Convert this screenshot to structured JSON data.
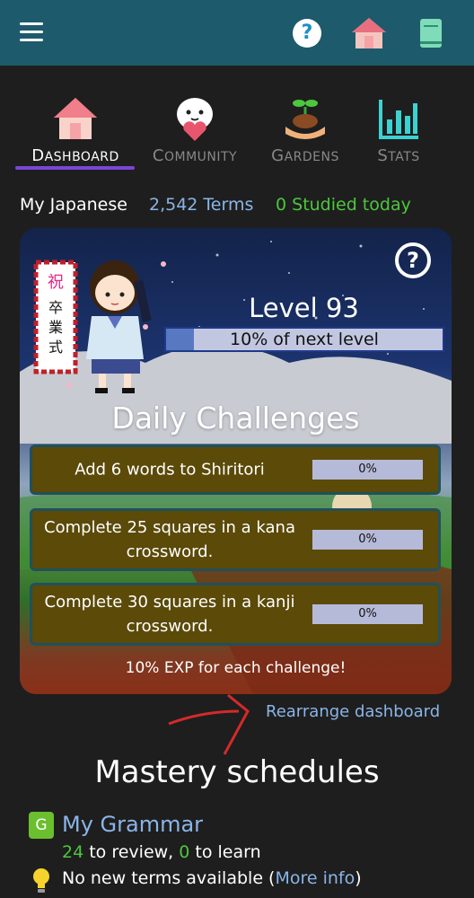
{
  "topbar": {
    "menu_icon": "hamburger-menu-icon",
    "help_icon": "question-circle-icon",
    "home_icon": "house-icon",
    "notebook_icon": "notebook-icon"
  },
  "tabs": [
    {
      "cap": "D",
      "rest": "ASHBOARD",
      "icon": "house-icon",
      "active": true
    },
    {
      "cap": "C",
      "rest": "OMMUNITY",
      "icon": "smiley-heart-icon",
      "active": false
    },
    {
      "cap": "G",
      "rest": "ARDENS",
      "icon": "sprout-hand-icon",
      "active": false
    },
    {
      "cap": "S",
      "rest": "TATS",
      "icon": "bar-chart-icon",
      "active": false
    }
  ],
  "subject": {
    "name": "My Japanese",
    "terms": "2,542 Terms",
    "studied": "0 Studied today"
  },
  "card": {
    "sign_text": "祝卒業式",
    "level": "Level 93",
    "level_progress": 0.1,
    "level_text": "10% of next level",
    "daily_title": "Daily Challenges",
    "challenges": [
      {
        "text": "Add 6 words to Shiritori",
        "progress": "0%"
      },
      {
        "text": "Complete 25 squares in a kana crossword.",
        "progress": "0%"
      },
      {
        "text": "Complete 30 squares in a kanji crossword.",
        "progress": "0%"
      }
    ],
    "exp_note": "10% EXP for each challenge!"
  },
  "rearrange_link": "Rearrange dashboard",
  "mastery": {
    "title": "Mastery schedules",
    "badge": "G",
    "grammar_name": "My Grammar",
    "review_count": "24",
    "review_text": " to review, ",
    "learn_count": "0",
    "learn_text": " to learn",
    "nonew_text": "No new terms available (",
    "more_info": "More info",
    "close_paren": ")"
  },
  "colors": {
    "topbar": "#1d5a6b",
    "background": "#1e1e1e",
    "accent_purple": "#7b46d6",
    "link_blue": "#8ab5e8",
    "green": "#4cc73e",
    "challenge_bg": "#5b4a08"
  }
}
